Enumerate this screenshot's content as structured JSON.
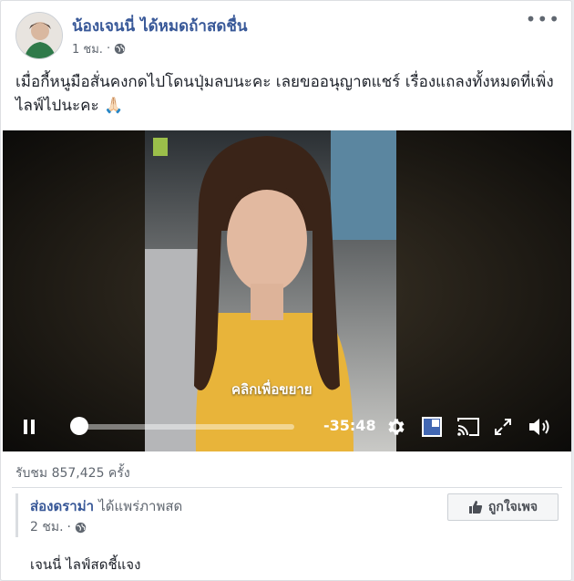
{
  "post": {
    "author": "น้องเจนนี่ ได้หมดถ้าสดชื่น",
    "time": "1 ชม.",
    "separator": "·",
    "text": "เมื่อกี้หนูมือสั่นคงกดไปโดนปุ่มลบนะคะ เลยขออนุญาตแชร์ เรื่องแถลงทั้งหมดที่เพิ่งไลฟ์ไปนะคะ",
    "emoji": "🙏🏻",
    "privacy_icon": "globe-icon",
    "more_icon": "more-options-icon"
  },
  "video": {
    "overlay_hint": "คลิกเพื่อขยาย",
    "time_remaining": "-35:48",
    "progress": 0.0,
    "controls": {
      "pause_icon": "pause-icon",
      "settings_icon": "gear-icon",
      "pip_icon": "picture-in-picture-icon",
      "cast_icon": "cast-icon",
      "fullscreen_icon": "fullscreen-icon",
      "volume_icon": "volume-icon"
    },
    "accent_color": "#4267b2"
  },
  "stats": {
    "views": "รับชม 857,425 ครั้ง"
  },
  "shared": {
    "page_name": "ส่องดราม่า",
    "action": "ได้แพร่ภาพสด",
    "time": "2 ชม.",
    "separator": "·",
    "like_label": "ถูกใจเพจ",
    "description": "เจนนี่ ไลฟ์สดชี้แจง"
  }
}
